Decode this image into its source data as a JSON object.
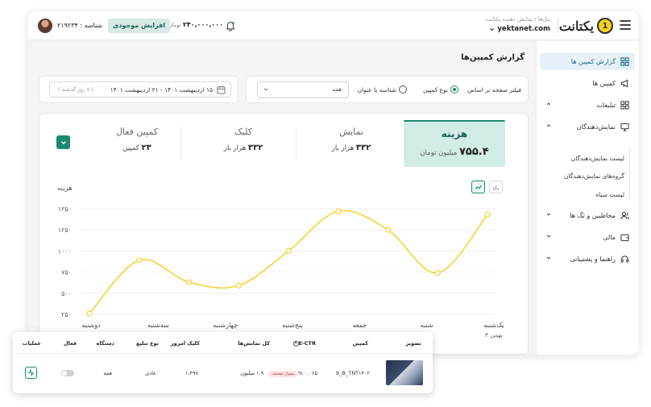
{
  "header": {
    "logo_text": "یکتانت",
    "logo_digit": "1",
    "breadcrumb": "پنل‌ها / نمایش دهنده یکتانت",
    "account_name": "yektanet.com",
    "balance_value": "۲۴۰,۰۰۰,۰۰۰",
    "balance_unit": "تومان",
    "topup_label": "افزایش موجودی",
    "user_id": "شناسه : ۲۱۹۲۳۴"
  },
  "sidebar": {
    "items": [
      {
        "label": "گزارش کمپین ها",
        "icon": "grid-icon",
        "active": true
      },
      {
        "label": "کمپین ها",
        "icon": "megaphone-icon"
      },
      {
        "label": "تبلیغات",
        "icon": "grid-icon"
      },
      {
        "label": "نمایش‌دهندگان",
        "icon": "monitor-icon"
      },
      {
        "label": "مخاطبین و تگ ها",
        "icon": "users-icon"
      },
      {
        "label": "مالی",
        "icon": "wallet-icon"
      },
      {
        "label": "راهنما و پشتیبانی",
        "icon": "headset-icon"
      }
    ],
    "sub_items": [
      "لیست نمایش‌دهندگان",
      "گروه‌های نمایش‌دهندگان",
      "لیست سیاه"
    ]
  },
  "page": {
    "title": "گزارش کمپین‌ها"
  },
  "filter": {
    "label": "فیلتر صفحه بر اساس",
    "options": [
      "نوع کمپین",
      "شناسه یا عنوان"
    ],
    "selected": "نوع کمپین",
    "select_value": "همه"
  },
  "date_range": {
    "dates": "۱۵ اردیبهشت ۱۴۰۱  -  ۲۱ اردیبهشت ۱۴۰۱",
    "relative": "( ۷ روز گذشته )"
  },
  "kpis": [
    {
      "title": "هزینه",
      "value": "۷۵۵.۴",
      "unit": "میلیون تومان",
      "active": true
    },
    {
      "title": "نمایش",
      "value": "۳۳۲",
      "unit": "هزار بار"
    },
    {
      "title": "کلیک",
      "value": "۳۳۲",
      "unit": "هزار بار"
    },
    {
      "title": "کمپین فعال",
      "value": "۲۳",
      "unit": "کمپین"
    }
  ],
  "chart_data": {
    "type": "line",
    "ylabel": "هزینه",
    "categories": [
      "یک‌شنبه",
      "شنبه",
      "جمعه",
      "پنج‌شنبه",
      "چهارشنبه",
      "سه‌شنبه",
      "دوشنبه"
    ],
    "category_sublabel": "۳ بهمن",
    "ytick_labels": [
      "۲۵۰",
      "۵۰۰",
      "۷۵۰",
      "۱۰۰۰",
      "۱۲۵۰",
      "۱۲۵۰"
    ],
    "yticks": [
      250,
      500,
      750,
      1000,
      1250,
      1500
    ],
    "ylim": [
      250,
      1500
    ],
    "x": [
      1,
      2,
      3,
      4,
      5,
      6,
      7,
      8,
      9
    ],
    "values": [
      1430,
      740,
      1250,
      1470,
      1000,
      590,
      630,
      890,
      260
    ],
    "color": "#f5d333",
    "grid": true
  },
  "table": {
    "headers": [
      "تصویر",
      "کمپین",
      "E-CTR",
      "کل نمایش‌ها",
      "کلیک امروز",
      "نوع تبلیغ",
      "دستگاه",
      "فعال",
      "عملیات"
    ],
    "row": {
      "campaign": "b_B_TNT۱۴۰۲",
      "ectr": "۰.۰۶۵ %",
      "ectr_badge": "بسیار ضعیف",
      "impressions": "۱.۹ میلیون",
      "clicks_today": "۱,۴۹۸",
      "ad_type": "عادی",
      "device": "همه",
      "active": false
    }
  },
  "colors": {
    "accent": "#1a8a6f",
    "active_bg": "#d2ece8",
    "line": "#f5d333"
  }
}
